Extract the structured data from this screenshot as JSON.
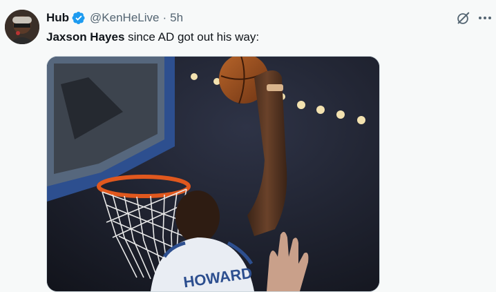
{
  "tweet": {
    "display_name": "Hub",
    "handle": "@KenHeLive",
    "separator": "·",
    "time": "5h",
    "text_bold": "Jaxson Hayes",
    "text_rest": " since AD got out his way:"
  },
  "media": {
    "jersey_text": "HOWARD"
  },
  "icons": {
    "verified": "verified-badge-icon",
    "grok": "grok-icon",
    "more": "more-options-icon"
  },
  "colors": {
    "verified": "#1d9bf0",
    "text_secondary": "#536471",
    "text_primary": "#0f1419",
    "background": "#f7f9f9"
  }
}
